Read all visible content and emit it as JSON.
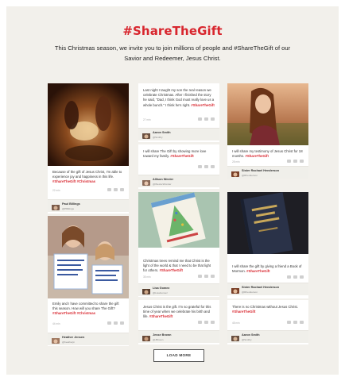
{
  "header": {
    "title": "#ShareTheGift",
    "subtitle": "This Christmas season, we invite you to join millions of people and #ShareTheGift of our Savior and Redeemer, Jesus Christ."
  },
  "colors": {
    "accent": "#d8262e",
    "background": "#f2f0eb",
    "card": "#ffffff",
    "author_bar": "#f0efea"
  },
  "icons": {
    "actions": [
      "reply-icon",
      "retweet-icon",
      "favorite-icon"
    ]
  },
  "posts": [
    {
      "text_before": "Because of the gift of Jesus Christ, I'm able to experience joy and happiness in this life.",
      "tags": [
        "#ShareTheGift",
        "#Christmas"
      ],
      "time": "22 min",
      "name": "Paul Billings",
      "handle": "@PBillings"
    },
    {
      "text_before": "Last night I taught my son the real reason we celebrate Christmas. After I finished the story he said, \"Dad, I think God must really love us a whole bunch.\" I think he's right.",
      "tags": [
        "#ShareTheGift"
      ],
      "time": "27 min",
      "name": "Aaron Smith",
      "handle": "@Smithy"
    },
    {
      "text_before": "I will share my testimony of Jesus Christ for 18 months.",
      "tags": [
        "#ShareTheGift"
      ],
      "time": "28 min",
      "name": "Sister Rachael Henderson",
      "handle": "@Rhenderson"
    },
    {
      "text_before": "I will share The Gift by showing more love toward my family.",
      "tags": [
        "#ShareTheGift"
      ],
      "time": "",
      "name": "Allison Wexler",
      "handle": "@WexlerWonder"
    },
    {
      "text_before": "Christmas trees remind me that Christ is the light of the world & that I need to be that light for others.",
      "tags": [
        "#ShareTheGift"
      ],
      "time": "35 min",
      "name": "Lisa Gomez",
      "handle": "@LisaGomez"
    },
    {
      "text_before": "I will share the gift by giving a friend a Book of Mormon.",
      "tags": [
        "#ShareTheGift"
      ],
      "time": "",
      "name": "Sister Rachael Henderson",
      "handle": "@Rhenderson"
    },
    {
      "text_before": "Emily and I have committed to share the gift this season. How will you share The Gift?",
      "tags": [
        "#ShareTheGift",
        "#Christmas"
      ],
      "time": "44 min",
      "name": "Heather Jensen",
      "handle": "@heatherjn"
    },
    {
      "text_before": "Jesus Christ is the gift. I'm so grateful for this time of year when we celebrate his birth and life.",
      "tags": [
        "#ShareTheGift"
      ],
      "time": "",
      "name": "Jesse Brown",
      "handle": "@JBrown"
    },
    {
      "text_before": "There is no Christmas without Jesus Christ.",
      "tags": [
        "#ShareTheGift"
      ],
      "time": "48 min",
      "name": "Aaron Smith",
      "handle": "@Smithy"
    }
  ],
  "load_more": {
    "label": "LOAD MORE"
  }
}
